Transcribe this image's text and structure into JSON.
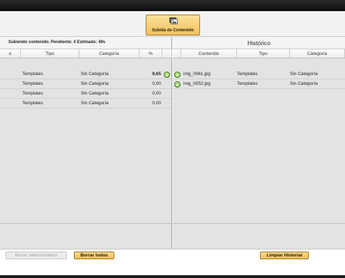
{
  "toolbar": {
    "upload_label": "Subida de Contenido"
  },
  "left_panel": {
    "status": "Subiendo contenido. Pendiente: 4 Estimado: 49s",
    "columns": [
      "o",
      "Tipo",
      "Categoría",
      "%"
    ],
    "rows": [
      {
        "tipo": "Templates",
        "categoria": "Sin Categoría",
        "pct": "9,65",
        "done": true
      },
      {
        "tipo": "Templates",
        "categoria": "Sin Categoría",
        "pct": "0,00",
        "done": false
      },
      {
        "tipo": "Templates",
        "categoria": "Sin Categoría",
        "pct": "0,00",
        "done": false
      },
      {
        "tipo": "Templates",
        "categoria": "Sin Categoría",
        "pct": "0,00",
        "done": false
      }
    ],
    "buttons": {
      "delete_selected": "Borrar seleccionados",
      "delete_all": "Borrar todos"
    }
  },
  "right_panel": {
    "title": "Histórico",
    "columns": [
      "Contenido",
      "Tipo",
      "Categoría"
    ],
    "rows": [
      {
        "contenido": "img_0061.jpg",
        "tipo": "Templates",
        "categoria": "Sin Categoría"
      },
      {
        "contenido": "img_0052.jpg",
        "tipo": "Templates",
        "categoria": "Sin Categoría"
      }
    ],
    "buttons": {
      "clear_history": "Limpiar Historial"
    }
  },
  "colors": {
    "accent_orange": "#f0bf57",
    "ok_green": "#5fa52b",
    "panel_bg": "#e3e3e3"
  }
}
